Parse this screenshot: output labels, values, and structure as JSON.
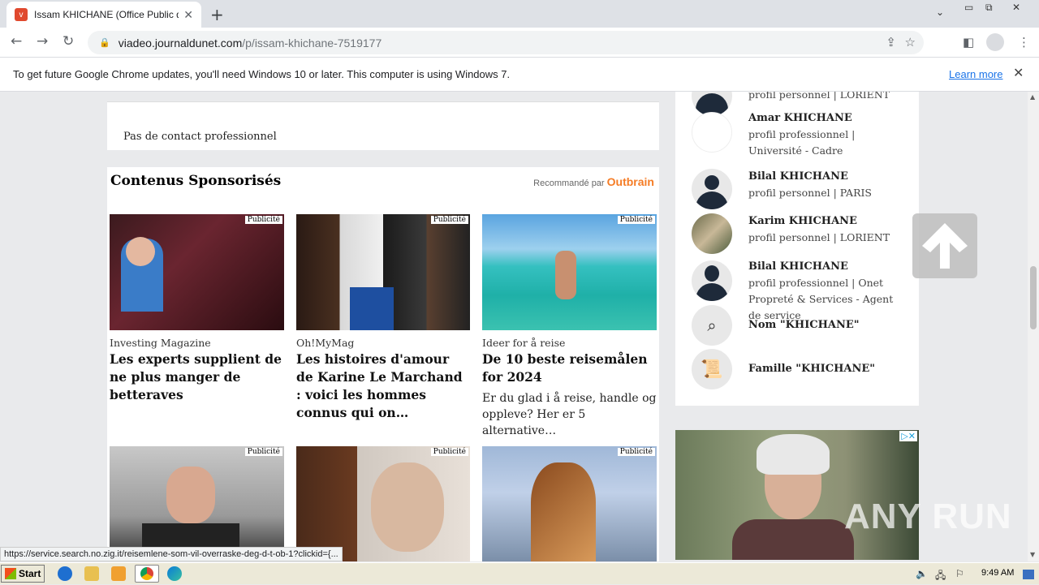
{
  "browser": {
    "tab_title": "Issam KHICHANE (Office Public de T",
    "favicon_label": "v",
    "url_host": "viadeo.journaldunet.com",
    "url_path": "/p/issam-khichane-7519177"
  },
  "infobar": {
    "message": "To get future Google Chrome updates, you'll need Windows 10 or later. This computer is using Windows 7.",
    "learn_more": "Learn more"
  },
  "contacts_card": {
    "text": "Pas de contact professionnel"
  },
  "sponsored": {
    "heading": "Contenus Sponsorisés",
    "recommended_by": "Recommandé par",
    "outbrain": "Outbrain",
    "badge": "Publicité",
    "items": [
      {
        "source": "Investing Magazine",
        "title": "Les experts supplient de ne plus manger de betteraves",
        "desc": ""
      },
      {
        "source": "Oh!MyMag",
        "title": "Les histoires d'amour de Karine Le Marchand : voici les hommes connus qui on…",
        "desc": ""
      },
      {
        "source": "Ideer for å reise",
        "title": "De 10 beste reisemålen for 2024",
        "desc": "Er du glad i å reise, handle og oppleve? Her er 5 alternative…"
      }
    ]
  },
  "side": {
    "people": [
      {
        "name": "",
        "desc": "profil personnel | LORIENT"
      },
      {
        "name": "Amar KHICHANE",
        "desc": "profil professionnel | Université - Cadre"
      },
      {
        "name": "Bilal KHICHANE",
        "desc": "profil personnel | PARIS"
      },
      {
        "name": "Karim KHICHANE",
        "desc": "profil personnel | LORIENT"
      },
      {
        "name": "Bilal KHICHANE",
        "desc": "profil professionnel | Onet Propreté & Services - Agent de service"
      }
    ],
    "search_name": "Nom \"KHICHANE\"",
    "search_family": "Famille \"KHICHANE\""
  },
  "status_url": "https://service.search.no.zig.it/reisemlene-som-vil-overraske-deg-d-t-ob-1?clickid={...",
  "watermark": "ANY RUN",
  "taskbar": {
    "start": "Start",
    "clock": "9:49 AM"
  }
}
